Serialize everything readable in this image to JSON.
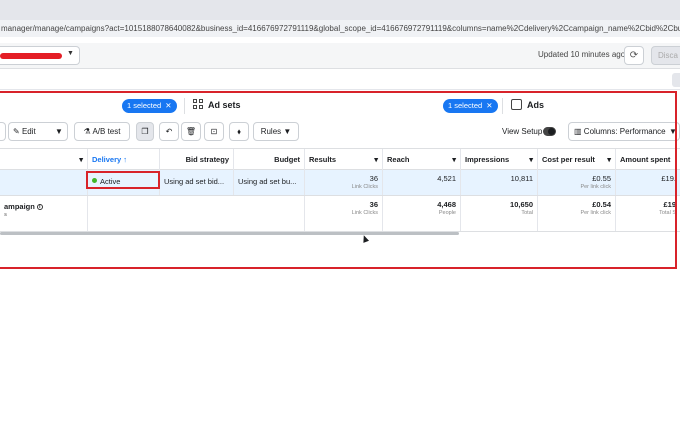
{
  "browser": {
    "url": "manager/manage/campaigns?act=1015188078640082&business_id=416676972791119&global_scope_id=416676972791119&columns=name%2Cdelivery%2Ccampaign_name%2Cbid%2Cbudget%"
  },
  "header": {
    "updated_text": "Updated 10 minutes ago",
    "discard_label": "Disca"
  },
  "tabs": {
    "campaigns_selected": "1 selected",
    "adsets_label": "Ad sets",
    "adsets_selected": "1 selected",
    "ads_label": "Ads"
  },
  "toolbar": {
    "edit_label": "Edit",
    "abtest_label": "A/B test",
    "rules_label": "Rules",
    "view_setup_label": "View Setup",
    "columns_label": "Columns: Performance"
  },
  "table": {
    "headers": {
      "delivery": "Delivery ↑",
      "bid_strategy": "Bid strategy",
      "budget": "Budget",
      "results": "Results",
      "reach": "Reach",
      "impressions": "Impressions",
      "cost_per_result": "Cost per result",
      "amount_spent": "Amount spent"
    },
    "selected_row": {
      "delivery": "Active",
      "bid_strategy": "Using ad set bid...",
      "budget": "Using ad set bu...",
      "results": "36",
      "results_sub": "Link Clicks",
      "reach": "4,521",
      "impressions": "10,811",
      "cost_per_result": "£0.55",
      "cost_sub": "Per link click",
      "amount_spent": "£19."
    },
    "total_row": {
      "name": "ampaign",
      "name_sub": "s",
      "results": "36",
      "results_sub": "Link Clicks",
      "reach": "4,468",
      "reach_sub": "People",
      "impressions": "10,650",
      "impressions_sub": "Total",
      "cost_per_result": "£0.54",
      "cost_sub": "Per link click",
      "amount_spent": "£19",
      "amount_sub": "Total S"
    }
  },
  "colors": {
    "accent": "#1877f2",
    "highlight": "#d8232a",
    "active": "#42b72a",
    "selected_row": "#e7f3ff"
  }
}
